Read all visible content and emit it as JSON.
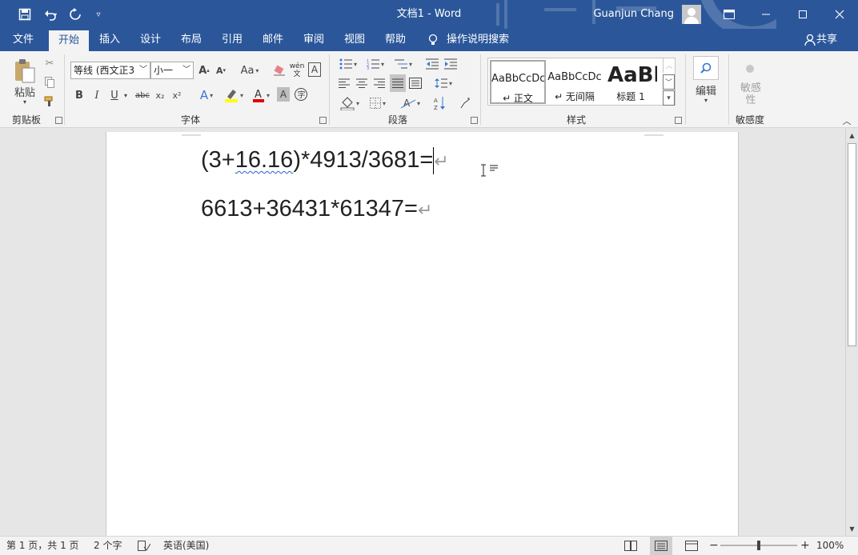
{
  "titlebar": {
    "doc_title": "文档1  -  Word",
    "user_name": "Guanjun Chang",
    "qa_icons": [
      "save-icon",
      "undo-icon",
      "redo-icon",
      "customize-icon"
    ]
  },
  "tabs": [
    "文件",
    "开始",
    "插入",
    "设计",
    "布局",
    "引用",
    "邮件",
    "审阅",
    "视图",
    "帮助"
  ],
  "tell_me": "操作说明搜索",
  "share": "共享",
  "ribbon": {
    "clipboard": {
      "paste": "粘贴",
      "label": "剪贴板"
    },
    "font": {
      "name": "等线 (西文正3",
      "size": "小一",
      "label": "字体",
      "aa": "Aa",
      "phonetic": "wén\n文",
      "bold": "B",
      "italic": "I",
      "underline": "U",
      "strike": "abc",
      "sub": "x₂",
      "sup": "x²"
    },
    "paragraph": {
      "label": "段落"
    },
    "styles": {
      "label": "样式",
      "items": [
        {
          "preview": "AaBbCcDc",
          "name": "↵ 正文"
        },
        {
          "preview": "AaBbCcDc",
          "name": "↵ 无间隔"
        },
        {
          "preview": "AaBb",
          "name": "标题 1"
        }
      ]
    },
    "editing": {
      "label": "编辑"
    },
    "sensitivity": {
      "button": "敏感\n性",
      "label": "敏感度"
    }
  },
  "document": {
    "line1_pre": "(3+",
    "line1_squiggle": "16.16",
    "line1_post": ")*4913/3681=",
    "line2": "6613+36431*61347=",
    "para_mark": "↵"
  },
  "status": {
    "page": "第 1 页，共 1 页",
    "words": "2 个字",
    "language": "英语(美国)",
    "zoom": "100%"
  },
  "colors": {
    "brand": "#2b579a",
    "highlight": "#ffff00",
    "font_color": "#e00000"
  }
}
